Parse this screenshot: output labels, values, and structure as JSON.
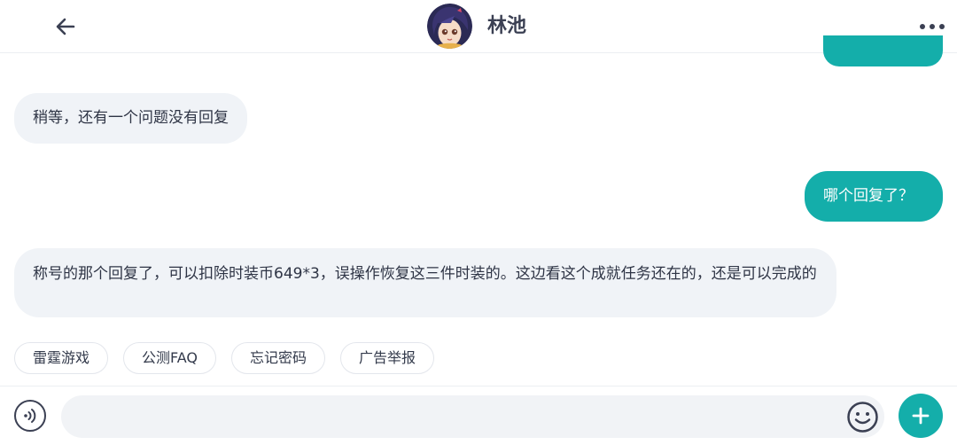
{
  "header": {
    "title": "林池",
    "back_icon": "arrow-left-icon",
    "more_icon": "more-horizontal-icon",
    "avatar_icon": "avatar"
  },
  "messages": [
    {
      "side": "in",
      "text": "稍等，还有一个问题没有回复"
    },
    {
      "side": "out",
      "text": "哪个回复了？"
    },
    {
      "side": "in",
      "text": "称号的那个回复了，可以扣除时装币649*3，误操作恢复这三件时装的。这边看这个成就任务还在的，还是可以完成的"
    }
  ],
  "quick_replies": [
    "雷霆游戏",
    "公测FAQ",
    "忘记密码",
    "广告举报"
  ],
  "input_bar": {
    "placeholder": "",
    "value": "",
    "voice_icon": "voice-icon",
    "emoji_icon": "emoji-icon",
    "add_icon": "plus-icon"
  },
  "colors": {
    "accent": "#14aeaa",
    "incoming_bubble": "#f0f3f7",
    "title_text": "#3b4053"
  }
}
